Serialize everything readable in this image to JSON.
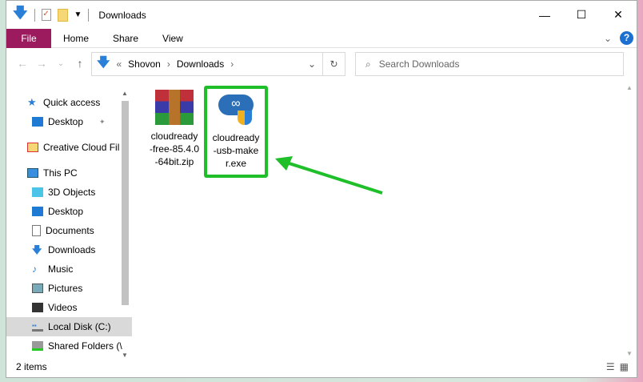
{
  "window": {
    "title": "Downloads",
    "minimize": "—",
    "maximize": "☐",
    "close": "✕"
  },
  "ribbon": {
    "tabs": [
      "File",
      "Home",
      "Share",
      "View"
    ],
    "expand": "⌄",
    "help": "?"
  },
  "nav": {
    "back": "←",
    "forward": "→",
    "recent": "⌄",
    "up": "↑",
    "path_overflow": "«",
    "path": [
      "Shovon",
      "Downloads"
    ],
    "sep": "›",
    "dropdown": "⌄",
    "refresh": "↻",
    "search_placeholder": "Search Downloads"
  },
  "sidebar": {
    "items": [
      {
        "label": "Quick access",
        "icon": "star-icon"
      },
      {
        "label": "Desktop",
        "icon": "desktop-icon",
        "pin": "📌"
      },
      {
        "label": "Creative Cloud Fil",
        "icon": "creative-cloud-icon"
      },
      {
        "label": "This PC",
        "icon": "pc-icon"
      },
      {
        "label": "3D Objects",
        "icon": "3d-objects-icon"
      },
      {
        "label": "Desktop",
        "icon": "desktop-icon"
      },
      {
        "label": "Documents",
        "icon": "documents-icon"
      },
      {
        "label": "Downloads",
        "icon": "downloads-icon"
      },
      {
        "label": "Music",
        "icon": "music-icon"
      },
      {
        "label": "Pictures",
        "icon": "pictures-icon"
      },
      {
        "label": "Videos",
        "icon": "videos-icon"
      },
      {
        "label": "Local Disk (C:)",
        "icon": "disk-icon"
      },
      {
        "label": "Shared Folders (\\",
        "icon": "network-drive-icon"
      }
    ]
  },
  "files": [
    {
      "name": "cloudready-free-85.4.0-64bit.zip",
      "lines": [
        "cloudready",
        "-free-85.4.0",
        "-64bit.zip"
      ]
    },
    {
      "name": "cloudready-usb-maker.exe",
      "lines": [
        "cloudready",
        "-usb-make",
        "r.exe"
      ]
    }
  ],
  "status": {
    "count": "2 items"
  },
  "colors": {
    "file_tab": "#9b1b5e",
    "highlight": "#1fbf2a",
    "accent": "#1a6fd0"
  }
}
